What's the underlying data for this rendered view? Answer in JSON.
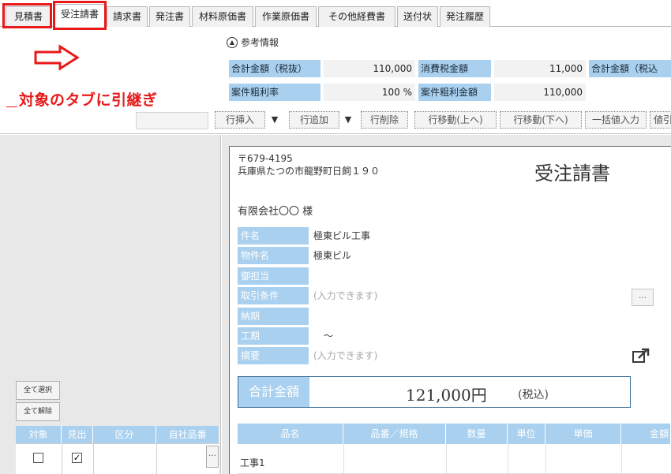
{
  "tabs": [
    "見積書",
    "受注請書",
    "請求書",
    "発注書",
    "材料原価書",
    "作業原価書",
    "その他経費書",
    "送付状",
    "発注履歴"
  ],
  "annotation": "対象のタブに引継ぎ",
  "reference": {
    "title": "参考情報",
    "subtotal_label": "合計金額（税抜）",
    "subtotal_value": "110,000",
    "tax_label": "消費税金額",
    "tax_value": "11,000",
    "total_label": "合計金額（税込",
    "margin_rate_label": "案件粗利率",
    "margin_rate_value": "100 %",
    "margin_amount_label": "案件粗利金額",
    "margin_amount_value": "110,000"
  },
  "toolbar": {
    "insert_row": "行挿入",
    "add_row": "行追加",
    "delete_row": "行削除",
    "move_up": "行移動(上へ)",
    "move_down": "行移動(下へ)",
    "bulk_input": "一括値入力",
    "value": "値引",
    "dropdown_glyph": "▼"
  },
  "left_panel": {
    "select_all": "全て選択",
    "deselect_all": "全て解除",
    "columns": [
      "対象",
      "見出",
      "区分",
      "自社品番"
    ],
    "row": {
      "target_checked": false,
      "heading_checked": true
    },
    "ellipsis": "…"
  },
  "document": {
    "postal": "〒679-4195",
    "address": "兵庫県たつの市龍野町日飼１９０",
    "title": "受注請書",
    "customer": "有限会社〇〇 様",
    "fields": [
      {
        "label": "件名",
        "value": "極東ビル工事",
        "placeholder": false
      },
      {
        "label": "物件名",
        "value": "極東ビル",
        "placeholder": false
      },
      {
        "label": "御担当",
        "value": "",
        "placeholder": false
      },
      {
        "label": "取引条件",
        "value": "(入力できます)",
        "placeholder": true
      },
      {
        "label": "納期",
        "value": "",
        "placeholder": false
      },
      {
        "label": "工期",
        "value": "～",
        "placeholder": false
      },
      {
        "label": "摘要",
        "value": "(入力できます)",
        "placeholder": true
      }
    ],
    "total_label": "合計金額",
    "total_value": "121,000円",
    "tax_note": "(税込)",
    "ellipsis": "…",
    "item_columns": [
      "品名",
      "品番／規格",
      "数量",
      "単位",
      "単価",
      "金額"
    ],
    "first_item": "工事1"
  },
  "colors": {
    "accent_blue": "#a9d0ee",
    "annotation_red": "#e8191a"
  }
}
